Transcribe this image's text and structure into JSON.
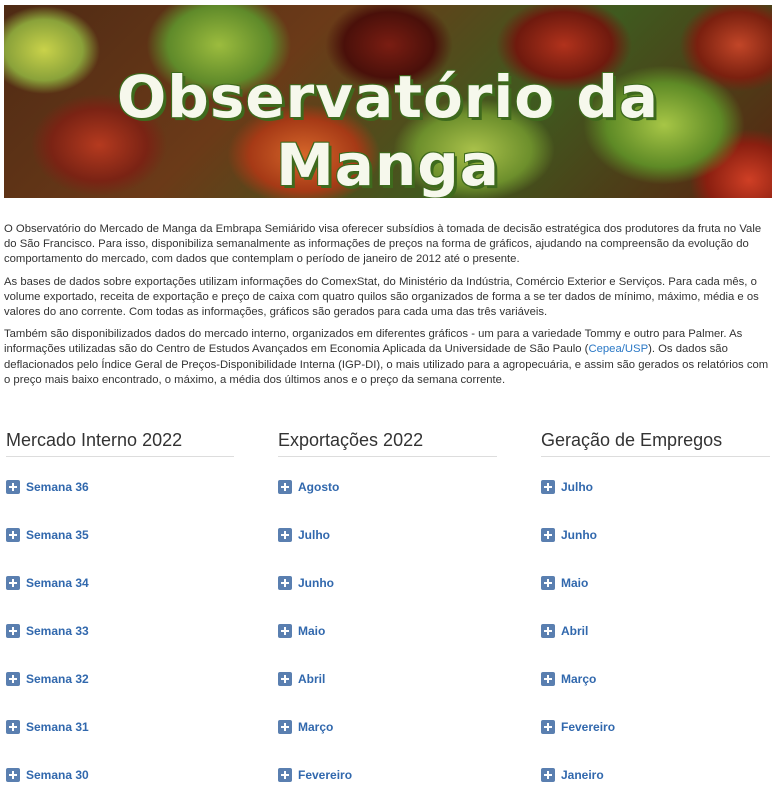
{
  "banner": {
    "title": "Observatório da Manga"
  },
  "intro": {
    "p1": "O Observatório do Mercado de Manga da Embrapa Semiárido visa oferecer subsídios à tomada de decisão estratégica dos produtores da fruta no Vale do São Francisco. Para isso, disponibiliza semanalmente as informações de preços na forma de gráficos, ajudando na compreensão da evolução do comportamento do mercado, com dados que contemplam o período de janeiro de 2012 até o presente.",
    "p2": "As bases de dados sobre exportações utilizam informações do ComexStat, do Ministério da Indústria, Comércio Exterior e Serviços. Para cada mês, o volume exportado, receita de exportação e preço de caixa com quatro quilos são organizados de forma a se ter dados de mínimo, máximo, média e os valores do ano corrente. Com todas as informações, gráficos são gerados para cada uma das três variáveis.",
    "p3_before": "Também são disponibilizados dados do mercado interno, organizados em diferentes gráficos - um para a variedade Tommy e outro para Palmer.  As informações utilizadas são do Centro de Estudos Avançados em Economia Aplicada da Universidade de São Paulo (",
    "p3_link": "Cepea/USP",
    "p3_after": "). Os dados são deflacionados pelo Índice Geral de Preços-Disponibilidade Interna (IGP-DI), o mais utilizado para a agropecuária, e assim são gerados os relatórios com o preço mais baixo encontrado, o máximo, a média dos últimos anos e o preço da semana corrente."
  },
  "columns": {
    "mercado_interno": {
      "title": "Mercado Interno 2022",
      "items": [
        "Semana 36",
        "Semana 35",
        "Semana 34",
        "Semana 33",
        "Semana 32",
        "Semana 31",
        "Semana 30"
      ]
    },
    "exportacoes": {
      "title": "Exportações 2022",
      "items": [
        "Agosto",
        "Julho",
        "Junho",
        "Maio",
        "Abril",
        "Março",
        "Fevereiro"
      ]
    },
    "empregos": {
      "title": "Geração de Empregos",
      "items": [
        "Julho",
        "Junho",
        "Maio",
        "Abril",
        "Março",
        "Fevereiro",
        "Janeiro"
      ]
    }
  }
}
